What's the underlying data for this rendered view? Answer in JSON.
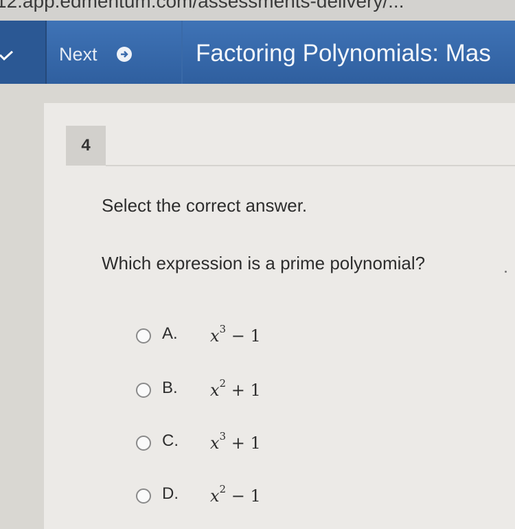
{
  "browser": {
    "url_fragment": "12.app.edmentum.com/assessments-delivery/..."
  },
  "header": {
    "next_label": "Next",
    "title": "Factoring Polynomials: Mas"
  },
  "question": {
    "number": "4",
    "instruction": "Select the correct answer.",
    "prompt": "Which expression is a prime polynomial?",
    "options": [
      {
        "letter": "A.",
        "var": "x",
        "exp": "3",
        "rest": " − 1"
      },
      {
        "letter": "B.",
        "var": "x",
        "exp": "2",
        "rest": " + 1"
      },
      {
        "letter": "C.",
        "var": "x",
        "exp": "3",
        "rest": " + 1"
      },
      {
        "letter": "D.",
        "var": "x",
        "exp": "2",
        "rest": " − 1"
      }
    ]
  },
  "colors": {
    "header": "#3a6bad",
    "background": "#eceae7"
  }
}
